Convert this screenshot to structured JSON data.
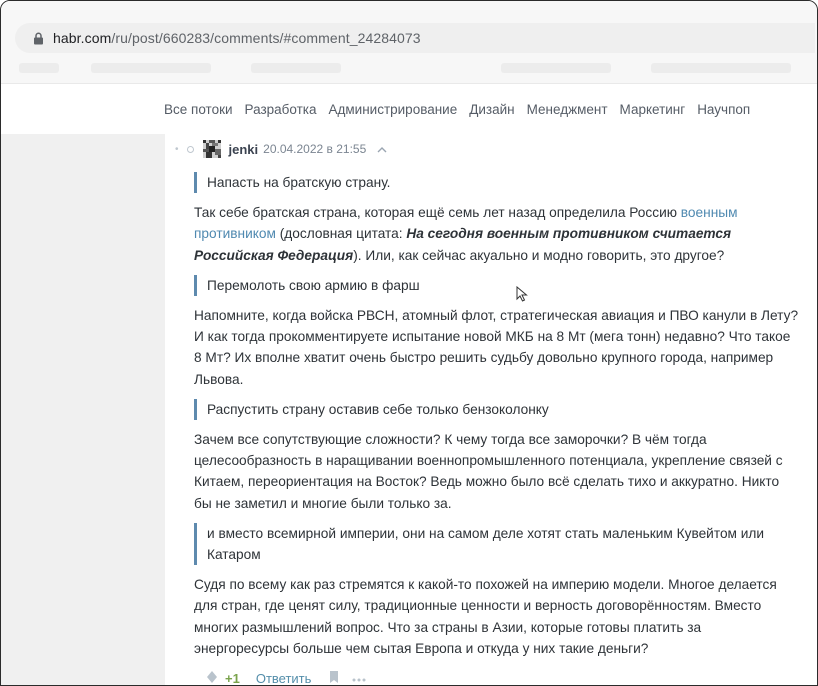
{
  "browser": {
    "url_host": "habr.com",
    "url_path": "/ru/post/660283/comments/#comment_24284073"
  },
  "nav": {
    "items": [
      "Все потоки",
      "Разработка",
      "Администрирование",
      "Дизайн",
      "Менеджмент",
      "Маркетинг",
      "Научпоп"
    ]
  },
  "comment": {
    "username": "jenki",
    "date": "20.04.2022 в 21:55",
    "quote1": "Напасть на братскую страну.",
    "p1_a": "Так себе братская страна, которая ещё семь лет назад определила Россию ",
    "p1_link": "военным противником",
    "p1_b": " (дословная цитата: ",
    "p1_em": "На сегодня военным противником считается Российская Федерация",
    "p1_c": "). Или, как сейчас акуально и модно говорить, это другое?",
    "quote2": "Перемолоть свою армию в фарш",
    "p2": "Напомните, когда войска РВСН, атомный флот, стратегическая авиация и ПВО канули в Лету? И как тогда прокомментируете испытание новой МКБ на 8 Мт (мега тонн) недавно? Что такое 8 Мт? Их вполне хватит очень быстро решить судьбу довольно крупного города, например Львова.",
    "quote3": "Распустить страну оставив себе только бензоколонку",
    "p3": "Зачем все сопутствующие сложности? К чему тогда все заморочки? В чём тогда целесообразность в наращивании военнопромышленного потенциала, укрепление связей с Китаем, переориентация на Восток? Ведь можно было всё сделать тихо и аккуратно. Никто бы не заметил и многие были только за.",
    "quote4": "и вместо всемирной империи, они на самом деле хотят стать маленьким Кувейтом или Катаром",
    "p4": "Судя по всему как раз стремятся к какой-то похожей на империю модели. Многое делается для стран, где ценят силу, традиционные ценности и верность договорённостям. Вместо многих размышлений вопрос. Что за страны в Азии, которые готовы платить за энергоресурсы больше чем сытая Европа и откуда у них такие деньги?",
    "score": "+1",
    "reply_label": "Ответить"
  },
  "colors": {
    "link": "#4f89b0",
    "quote_border": "#5e8aae",
    "score": "#7aa34c"
  },
  "icons": [
    "lock-icon",
    "avatar-icon",
    "chevron-up-icon",
    "vote-icon",
    "bookmark-icon",
    "more-icon",
    "mouse-cursor-icon"
  ]
}
